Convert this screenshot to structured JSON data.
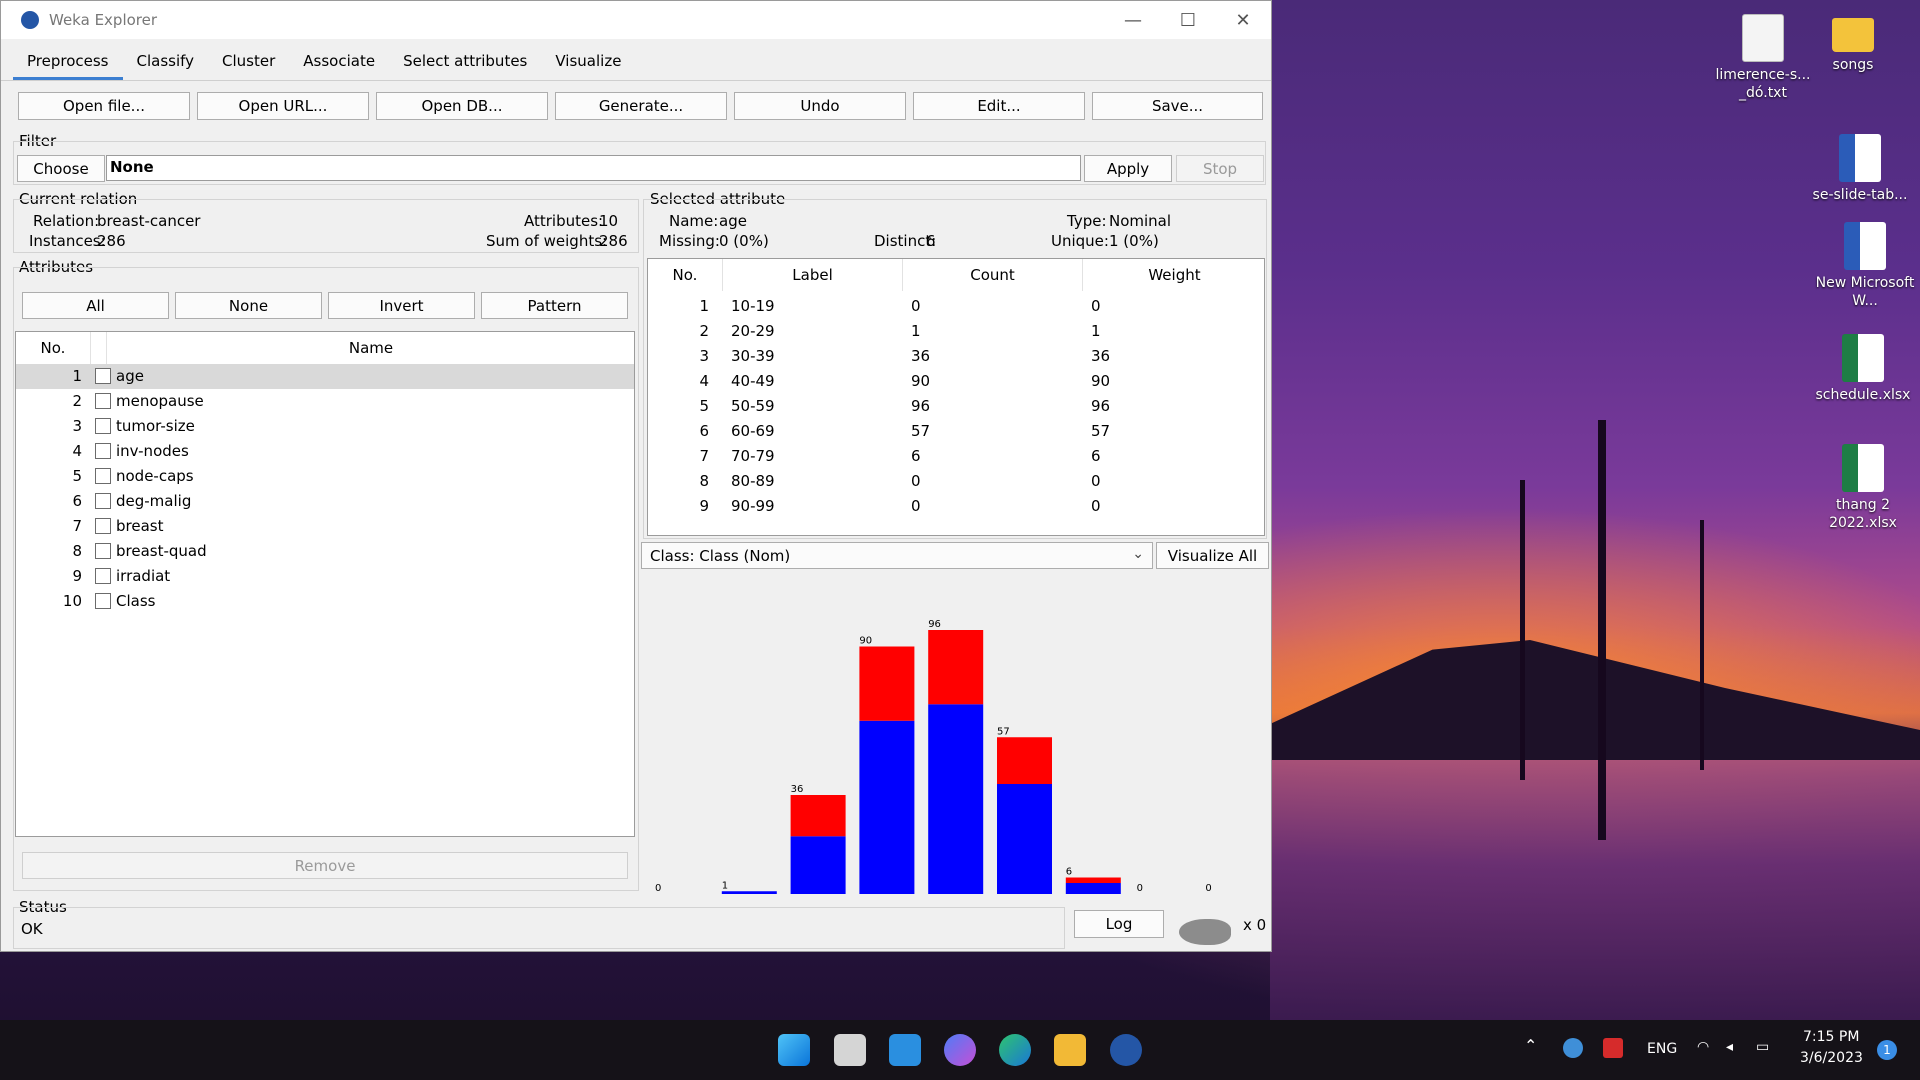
{
  "window": {
    "title": "Weka Explorer",
    "controls": {
      "minimize": "—",
      "maximize": "☐",
      "close": "✕"
    }
  },
  "tabs": [
    "Preprocess",
    "Classify",
    "Cluster",
    "Associate",
    "Select attributes",
    "Visualize"
  ],
  "toolbar": {
    "open_file": "Open file...",
    "open_url": "Open URL...",
    "open_db": "Open DB...",
    "generate": "Generate...",
    "undo": "Undo",
    "edit": "Edit...",
    "save": "Save..."
  },
  "filter": {
    "section": "Filter",
    "choose": "Choose",
    "value": "None",
    "apply": "Apply",
    "stop": "Stop"
  },
  "relation": {
    "section": "Current relation",
    "relation_label": "Relation:",
    "relation_value": "breast-cancer",
    "attributes_label": "Attributes:",
    "attributes_value": "10",
    "instances_label": "Instances:",
    "instances_value": "286",
    "weights_label": "Sum of weights:",
    "weights_value": "286"
  },
  "attributes": {
    "section": "Attributes",
    "all": "All",
    "none": "None",
    "invert": "Invert",
    "pattern": "Pattern",
    "col_no": "No.",
    "col_name": "Name",
    "items": [
      {
        "no": "1",
        "name": "age"
      },
      {
        "no": "2",
        "name": "menopause"
      },
      {
        "no": "3",
        "name": "tumor-size"
      },
      {
        "no": "4",
        "name": "inv-nodes"
      },
      {
        "no": "5",
        "name": "node-caps"
      },
      {
        "no": "6",
        "name": "deg-malig"
      },
      {
        "no": "7",
        "name": "breast"
      },
      {
        "no": "8",
        "name": "breast-quad"
      },
      {
        "no": "9",
        "name": "irradiat"
      },
      {
        "no": "10",
        "name": "Class"
      }
    ],
    "remove": "Remove"
  },
  "selected": {
    "section": "Selected attribute",
    "name_label": "Name:",
    "name_value": "age",
    "type_label": "Type:",
    "type_value": "Nominal",
    "missing_label": "Missing:",
    "missing_value": "0 (0%)",
    "distinct_label": "Distinct:",
    "distinct_value": "6",
    "unique_label": "Unique:",
    "unique_value": "1 (0%)",
    "cols": [
      "No.",
      "Label",
      "Count",
      "Weight"
    ],
    "rows": [
      {
        "no": "1",
        "label": "10-19",
        "count": "0",
        "weight": "0"
      },
      {
        "no": "2",
        "label": "20-29",
        "count": "1",
        "weight": "1"
      },
      {
        "no": "3",
        "label": "30-39",
        "count": "36",
        "weight": "36"
      },
      {
        "no": "4",
        "label": "40-49",
        "count": "90",
        "weight": "90"
      },
      {
        "no": "5",
        "label": "50-59",
        "count": "96",
        "weight": "96"
      },
      {
        "no": "6",
        "label": "60-69",
        "count": "57",
        "weight": "57"
      },
      {
        "no": "7",
        "label": "70-79",
        "count": "6",
        "weight": "6"
      },
      {
        "no": "8",
        "label": "80-89",
        "count": "0",
        "weight": "0"
      },
      {
        "no": "9",
        "label": "90-99",
        "count": "0",
        "weight": "0"
      }
    ]
  },
  "class_select": {
    "value": "Class: Class (Nom)",
    "visualize_all": "Visualize All"
  },
  "chart_data": {
    "type": "bar",
    "stacked": true,
    "categories": [
      "10-19",
      "20-29",
      "30-39",
      "40-49",
      "50-59",
      "60-69",
      "70-79",
      "80-89",
      "90-99"
    ],
    "totals": [
      0,
      1,
      36,
      90,
      96,
      57,
      6,
      0,
      0
    ],
    "series": [
      {
        "color": "#0000ff",
        "values": [
          0,
          1,
          21,
          63,
          69,
          40,
          4,
          0,
          0
        ]
      },
      {
        "color": "#ff0000",
        "values": [
          0,
          0,
          15,
          27,
          27,
          17,
          2,
          0,
          0
        ]
      }
    ],
    "ylim": [
      0,
      96
    ]
  },
  "status": {
    "section": "Status",
    "text": "OK",
    "log": "Log",
    "count": "x 0"
  },
  "desktop": {
    "icons": [
      {
        "label": "limerence-s... _dó.txt",
        "kind": "txt"
      },
      {
        "label": "songs",
        "kind": "folder"
      },
      {
        "label": "se-slide-tab...",
        "kind": "word"
      },
      {
        "label": "New Microsoft W...",
        "kind": "word"
      },
      {
        "label": "schedule.xlsx",
        "kind": "excel"
      },
      {
        "label": "thang 2 2022.xlsx",
        "kind": "excel"
      }
    ]
  },
  "taskbar": {
    "language": "ENG",
    "time": "7:15 PM",
    "date": "3/6/2023",
    "notification_count": "1",
    "apps": [
      "windows-start",
      "task-view",
      "vscode",
      "messenger",
      "edge",
      "file-explorer",
      "weka"
    ]
  },
  "colors": {
    "accent": "#3c7fd1",
    "bar_blue": "#0000ff",
    "bar_red": "#ff0000"
  }
}
